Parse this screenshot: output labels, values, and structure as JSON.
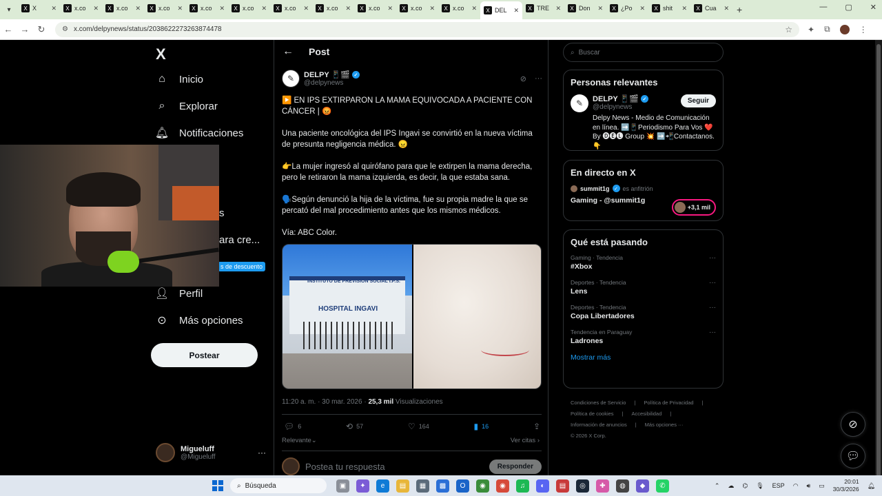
{
  "browser": {
    "tabs": [
      {
        "label": "X",
        "active": false
      },
      {
        "label": "x.co",
        "active": false
      },
      {
        "label": "x.co",
        "active": false
      },
      {
        "label": "x.co",
        "active": false
      },
      {
        "label": "x.co",
        "active": false
      },
      {
        "label": "x.co",
        "active": false
      },
      {
        "label": "x.co",
        "active": false
      },
      {
        "label": "x.co",
        "active": false
      },
      {
        "label": "x.co",
        "active": false
      },
      {
        "label": "x.co",
        "active": false
      },
      {
        "label": "x.co",
        "active": false
      },
      {
        "label": "DEL",
        "active": true
      },
      {
        "label": "TRE",
        "active": false
      },
      {
        "label": "Don",
        "active": false
      },
      {
        "label": "¿Po",
        "active": false
      },
      {
        "label": "shit",
        "active": false
      },
      {
        "label": "Cua",
        "active": false
      }
    ],
    "url": "x.com/delpynews/status/2038622273263874478"
  },
  "sidebar": {
    "logo": "X",
    "items": [
      {
        "label": "Inicio",
        "icon": "home-icon"
      },
      {
        "label": "Explorar",
        "icon": "search-icon"
      },
      {
        "label": "Notificaciones",
        "icon": "bell-icon"
      },
      {
        "label": "s",
        "icon": ""
      },
      {
        "label": "ara cre...",
        "icon": ""
      },
      {
        "label": "Perfil",
        "icon": "person-icon"
      },
      {
        "label": "Más opciones",
        "icon": "more-circle-icon"
      }
    ],
    "promo": "s de descuento",
    "post_button": "Postear",
    "user": {
      "name": "Migueluff",
      "handle": "@Migueluff"
    }
  },
  "post": {
    "header_title": "Post",
    "author_name": "DELPY 📱🎬",
    "author_handle": "@delpynews",
    "paragraphs": [
      "▶️ EN IPS EXTIRPARON LA MAMA EQUIVOCADA A PACIENTE CON CÁNCER | 😡",
      "Una paciente oncológica del IPS Ingavi se convirtió en la nueva víctima de presunta negligencia médica. 😠",
      "👉La mujer ingresó al quirófano para que le extirpen la mama derecha, pero le retiraron la mama izquierda, es decir, la que estaba sana.",
      "🗣️Según denunció la hija de la víctima, fue su propia madre la que se percató del mal procedimiento antes que los mismos médicos.",
      "Vía: ABC Color."
    ],
    "image_sign_top": "INSTITUTO DE PREVISION SOCIAL I.P.S.",
    "image_sign_main": "HOSPITAL INGAVI",
    "time": "11:20 a. m. · 30 mar. 2026 · ",
    "views_count": "25,3 mil",
    "views_label": " Visualizaciones",
    "replies": "6",
    "reposts": "57",
    "likes": "164",
    "bookmarks": "16",
    "sort_label": "Relevante",
    "quotes_label": "Ver citas",
    "reply_placeholder": "Postea tu respuesta",
    "reply_button": "Responder"
  },
  "right": {
    "search_placeholder": "Buscar",
    "relevant_title": "Personas relevantes",
    "relevant_name": "DELPY 📱🎬",
    "relevant_handle": "@delpynews",
    "follow_label": "Seguir",
    "relevant_bio": "Delpy News - Medio de Comunicación en línea. ➡️📱Periodismo Para Vos ❤️ By 🅓🅔🅛 Group 💥 ➡️📲Contactanos. 👇",
    "live_title": "En directo en X",
    "live_host_name": "summit1g",
    "live_host_suffix": "es anfitrión",
    "live_stream": "Gaming - @summit1g",
    "live_count": "+3,1 mil",
    "trends_title": "Qué está pasando",
    "trends": [
      {
        "category": "Gaming · Tendencia",
        "name": "#Xbox"
      },
      {
        "category": "Deportes · Tendencia",
        "name": "Lens"
      },
      {
        "category": "Deportes · Tendencia",
        "name": "Copa Libertadores"
      },
      {
        "category": "Tendencia en Paraguay",
        "name": "Ladrones"
      }
    ],
    "show_more": "Mostrar más",
    "footer_links": [
      "Condiciones de Servicio",
      "|",
      "Política de Privacidad",
      "|",
      "Política de cookies",
      "|",
      "Accesibilidad",
      "|",
      "Información de anuncios",
      "|",
      "Más opciones ···",
      "© 2026 X Corp."
    ]
  },
  "taskbar": {
    "search_label": "Búsqueda",
    "lang": "ESP",
    "time": "20:01",
    "date": "30/3/2026"
  },
  "colors": {
    "accent": "#1d9bf0",
    "live": "#f91880"
  }
}
